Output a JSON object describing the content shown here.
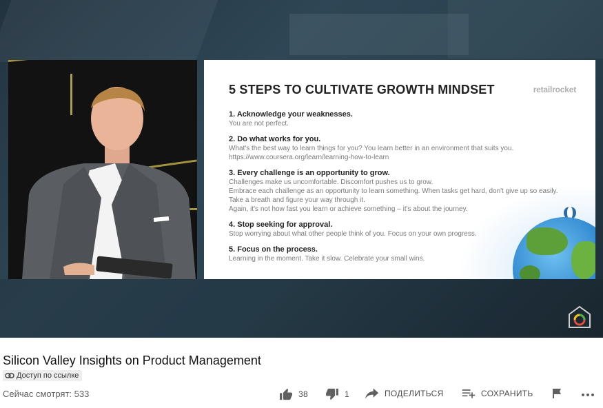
{
  "slide": {
    "title": "5 STEPS TO CULTIVATE GROWTH MINDSET",
    "brand": "retailrocket",
    "steps": [
      {
        "heading": "1. Acknowledge your weaknesses.",
        "lines": [
          "You are not perfect."
        ]
      },
      {
        "heading": "2. Do what works for you.",
        "lines": [
          "What's the best way to learn things for you? You learn better in an environment that suits you.",
          "https://www.coursera.org/learn/learning-how-to-learn"
        ]
      },
      {
        "heading": "3. Every challenge is an opportunity to grow.",
        "lines": [
          "Challenges make us uncomfortable. Discomfort pushes us to grow.",
          "Embrace each challenge as an opportunity to learn something. When tasks get hard, don't give up so easily. Take a breath and figure your way through it.",
          "Again, it's not how fast you learn or achieve something – it's about the journey."
        ]
      },
      {
        "heading": "4. Stop seeking for approval.",
        "lines": [
          "Stop worrying about what other people think of you. Focus on your own progress."
        ]
      },
      {
        "heading": "5. Focus on the process.",
        "lines": [
          "Learning in the moment. Take it slow. Celebrate your small wins."
        ]
      }
    ]
  },
  "video": {
    "title": "Silicon Valley Insights on Product Management",
    "visibility_badge": "Доступ по ссылке",
    "viewers": "Сейчас смотрят: 533"
  },
  "actions": {
    "like_count": "38",
    "dislike_count": "1",
    "share_label": "ПОДЕЛИТЬСЯ",
    "save_label": "СОХРАНИТЬ"
  },
  "icons": {
    "like": "thumb-up-icon",
    "dislike": "thumb-down-icon",
    "share": "share-arrow-icon",
    "save": "playlist-add-icon",
    "report": "flag-icon",
    "more": "more-horizontal-icon",
    "link": "link-icon"
  },
  "colors": {
    "player_bg": "#2a4250",
    "accent": "#c9b44a"
  }
}
